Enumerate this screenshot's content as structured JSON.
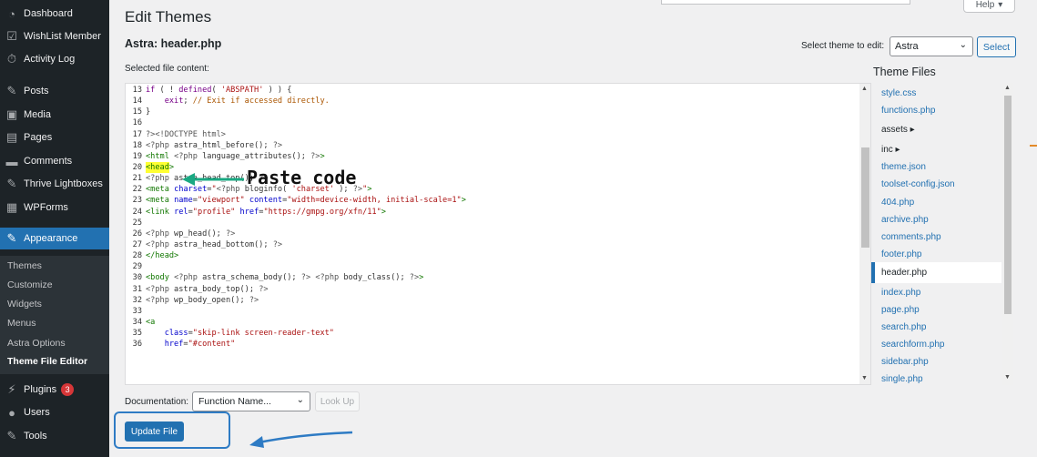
{
  "sidebar": {
    "items": [
      {
        "icon": "dashboard-icon",
        "glyph": "◔",
        "label": "Dashboard"
      },
      {
        "icon": "wishlist-icon",
        "glyph": "☑",
        "label": "WishList Member"
      },
      {
        "icon": "activity-log-icon",
        "glyph": "⏱",
        "label": "Activity Log"
      },
      {
        "icon": "posts-icon",
        "glyph": "✎",
        "label": "Posts"
      },
      {
        "icon": "media-icon",
        "glyph": "▣",
        "label": "Media"
      },
      {
        "icon": "pages-icon",
        "glyph": "▤",
        "label": "Pages"
      },
      {
        "icon": "comments-icon",
        "glyph": "▬",
        "label": "Comments"
      },
      {
        "icon": "thrive-lightboxes-icon",
        "glyph": "✎",
        "label": "Thrive Lightboxes"
      },
      {
        "icon": "wpforms-icon",
        "glyph": "▦",
        "label": "WPForms"
      },
      {
        "icon": "appearance-icon",
        "glyph": "✎",
        "label": "Appearance"
      },
      {
        "icon": "plugins-icon",
        "glyph": "⚡",
        "label": "Plugins",
        "badge": "3"
      },
      {
        "icon": "users-icon",
        "glyph": "●",
        "label": "Users"
      },
      {
        "icon": "tools-icon",
        "glyph": "✎",
        "label": "Tools"
      }
    ],
    "submenu": [
      "Themes",
      "Customize",
      "Widgets",
      "Menus",
      "Astra Options",
      "Theme File Editor"
    ]
  },
  "header": {
    "title": "Edit Themes",
    "help": "Help",
    "file_heading": "Astra: header.php",
    "selected_label": "Selected file content:",
    "select_theme_label": "Select theme to edit:",
    "select_theme_value": "Astra",
    "select_button": "Select"
  },
  "editor": {
    "lines": [
      {
        "n": "13",
        "parts": [
          [
            "key",
            "if"
          ],
          [
            "tx",
            " ( ! "
          ],
          [
            "key",
            "defined"
          ],
          [
            "tx",
            "( "
          ],
          [
            "str",
            "'ABSPATH'"
          ],
          [
            "tx",
            " ) ) {"
          ]
        ]
      },
      {
        "n": "14",
        "parts": [
          [
            "tx",
            "    "
          ],
          [
            "key",
            "exit"
          ],
          [
            "tx",
            "; "
          ],
          [
            "com",
            "// Exit if accessed directly."
          ]
        ]
      },
      {
        "n": "15",
        "parts": [
          [
            "tx",
            "}"
          ]
        ]
      },
      {
        "n": "16",
        "parts": []
      },
      {
        "n": "17",
        "parts": [
          [
            "meta",
            "?><!DOCTYPE html>"
          ]
        ]
      },
      {
        "n": "18",
        "parts": [
          [
            "meta",
            "<?php"
          ],
          [
            "tx",
            " astra_html_before(); "
          ],
          [
            "meta",
            "?>"
          ]
        ]
      },
      {
        "n": "19",
        "parts": [
          [
            "tag",
            "<html"
          ],
          [
            "tx",
            " "
          ],
          [
            "meta",
            "<?php"
          ],
          [
            "tx",
            " language_attributes(); "
          ],
          [
            "meta",
            "?>"
          ],
          [
            "tag",
            ">"
          ]
        ]
      },
      {
        "n": "20",
        "parts": [
          [
            "hl",
            "<head"
          ],
          [
            "tag",
            ">"
          ]
        ]
      },
      {
        "n": "21",
        "parts": [
          [
            "meta",
            "<?php"
          ],
          [
            "tx",
            " astra_head_top(); "
          ],
          [
            "meta",
            "?>"
          ]
        ]
      },
      {
        "n": "22",
        "parts": [
          [
            "tag",
            "<meta"
          ],
          [
            "tx",
            " "
          ],
          [
            "attr",
            "charset"
          ],
          [
            "tx",
            "="
          ],
          [
            "str",
            "\""
          ],
          [
            "meta",
            "<?php"
          ],
          [
            "tx",
            " bloginfo( "
          ],
          [
            "str",
            "'charset'"
          ],
          [
            "tx",
            " ); "
          ],
          [
            "meta",
            "?>"
          ],
          [
            "str",
            "\""
          ],
          [
            "tag",
            ">"
          ]
        ]
      },
      {
        "n": "23",
        "parts": [
          [
            "tag",
            "<meta"
          ],
          [
            "tx",
            " "
          ],
          [
            "attr",
            "name"
          ],
          [
            "tx",
            "="
          ],
          [
            "str",
            "\"viewport\""
          ],
          [
            "tx",
            " "
          ],
          [
            "attr",
            "content"
          ],
          [
            "tx",
            "="
          ],
          [
            "str",
            "\"width=device-width, initial-scale=1\""
          ],
          [
            "tag",
            ">"
          ]
        ]
      },
      {
        "n": "24",
        "parts": [
          [
            "tag",
            "<link"
          ],
          [
            "tx",
            " "
          ],
          [
            "attr",
            "rel"
          ],
          [
            "tx",
            "="
          ],
          [
            "str",
            "\"profile\""
          ],
          [
            "tx",
            " "
          ],
          [
            "attr",
            "href"
          ],
          [
            "tx",
            "="
          ],
          [
            "str",
            "\"https://gmpg.org/xfn/11\""
          ],
          [
            "tag",
            ">"
          ]
        ]
      },
      {
        "n": "25",
        "parts": []
      },
      {
        "n": "26",
        "parts": [
          [
            "meta",
            "<?php"
          ],
          [
            "tx",
            " wp_head(); "
          ],
          [
            "meta",
            "?>"
          ]
        ]
      },
      {
        "n": "27",
        "parts": [
          [
            "meta",
            "<?php"
          ],
          [
            "tx",
            " astra_head_bottom(); "
          ],
          [
            "meta",
            "?>"
          ]
        ]
      },
      {
        "n": "28",
        "parts": [
          [
            "tag",
            "</head>"
          ]
        ]
      },
      {
        "n": "29",
        "parts": []
      },
      {
        "n": "30",
        "parts": [
          [
            "tag",
            "<body"
          ],
          [
            "tx",
            " "
          ],
          [
            "meta",
            "<?php"
          ],
          [
            "tx",
            " astra_schema_body(); "
          ],
          [
            "meta",
            "?>"
          ],
          [
            "tx",
            " "
          ],
          [
            "meta",
            "<?php"
          ],
          [
            "tx",
            " body_class(); "
          ],
          [
            "meta",
            "?>"
          ],
          [
            "tag",
            ">"
          ]
        ]
      },
      {
        "n": "31",
        "parts": [
          [
            "meta",
            "<?php"
          ],
          [
            "tx",
            " astra_body_top(); "
          ],
          [
            "meta",
            "?>"
          ]
        ]
      },
      {
        "n": "32",
        "parts": [
          [
            "meta",
            "<?php"
          ],
          [
            "tx",
            " wp_body_open(); "
          ],
          [
            "meta",
            "?>"
          ]
        ]
      },
      {
        "n": "33",
        "parts": []
      },
      {
        "n": "34",
        "parts": [
          [
            "tag",
            "<a"
          ]
        ]
      },
      {
        "n": "35",
        "parts": [
          [
            "tx",
            "    "
          ],
          [
            "attr",
            "class"
          ],
          [
            "tx",
            "="
          ],
          [
            "str",
            "\"skip-link screen-reader-text\""
          ]
        ]
      },
      {
        "n": "36",
        "parts": [
          [
            "tx",
            "    "
          ],
          [
            "attr",
            "href"
          ],
          [
            "tx",
            "="
          ],
          [
            "str",
            "\"#content\""
          ]
        ]
      }
    ]
  },
  "files": {
    "title": "Theme Files",
    "items": [
      {
        "label": "style.css",
        "type": "file"
      },
      {
        "label": "functions.php",
        "type": "file"
      },
      {
        "label": "assets ▸",
        "type": "dir"
      },
      {
        "label": "inc ▸",
        "type": "dir"
      },
      {
        "label": "theme.json",
        "type": "file"
      },
      {
        "label": "toolset-config.json",
        "type": "file"
      },
      {
        "label": "404.php",
        "type": "file"
      },
      {
        "label": "archive.php",
        "type": "file"
      },
      {
        "label": "comments.php",
        "type": "file"
      },
      {
        "label": "footer.php",
        "type": "file"
      },
      {
        "label": "header.php",
        "type": "current"
      },
      {
        "label": "index.php",
        "type": "file"
      },
      {
        "label": "page.php",
        "type": "file"
      },
      {
        "label": "search.php",
        "type": "file"
      },
      {
        "label": "searchform.php",
        "type": "file"
      },
      {
        "label": "sidebar.php",
        "type": "file"
      },
      {
        "label": "single.php",
        "type": "file"
      }
    ]
  },
  "footer": {
    "documentation_label": "Documentation:",
    "function_placeholder": "Function Name...",
    "lookup_button": "Look Up",
    "update_button": "Update File"
  },
  "annotation": {
    "text": "Paste code"
  },
  "colors": {
    "sidebar_bg": "#1d2327",
    "accent": "#2271b1",
    "annotation_green": "#1aa882",
    "annotation_blue": "#2e7bc4"
  }
}
